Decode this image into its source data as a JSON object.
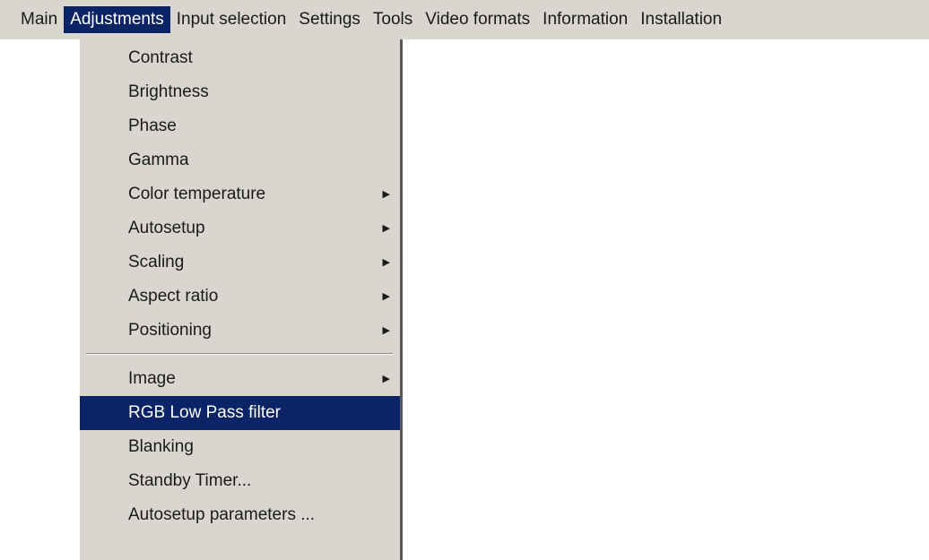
{
  "menubar": {
    "items": [
      {
        "label": "Main"
      },
      {
        "label": "Adjustments"
      },
      {
        "label": "Input selection"
      },
      {
        "label": "Settings"
      },
      {
        "label": "Tools"
      },
      {
        "label": "Video formats"
      },
      {
        "label": "Information"
      },
      {
        "label": "Installation"
      }
    ],
    "active": "Adjustments"
  },
  "dropdown": {
    "group1": [
      {
        "label": "Contrast",
        "submenu": false
      },
      {
        "label": "Brightness",
        "submenu": false
      },
      {
        "label": "Phase",
        "submenu": false
      },
      {
        "label": "Gamma",
        "submenu": false
      },
      {
        "label": "Color temperature",
        "submenu": true
      },
      {
        "label": "Autosetup",
        "submenu": true
      },
      {
        "label": "Scaling",
        "submenu": true
      },
      {
        "label": "Aspect ratio",
        "submenu": true
      },
      {
        "label": "Positioning",
        "submenu": true
      }
    ],
    "group2": [
      {
        "label": "Image",
        "submenu": true
      },
      {
        "label": "RGB Low Pass filter",
        "submenu": false
      },
      {
        "label": "Blanking",
        "submenu": false
      },
      {
        "label": "Standby Timer...",
        "submenu": false
      },
      {
        "label": "Autosetup parameters ...",
        "submenu": false
      }
    ],
    "highlighted": "RGB Low Pass filter"
  },
  "icons": {
    "submenu_arrow": "submenu-arrow-icon"
  },
  "colors": {
    "menu_background": "#d9d6d0",
    "highlight": "#0b2468",
    "highlight_text": "#ffffff",
    "text": "#1a1a1a"
  }
}
